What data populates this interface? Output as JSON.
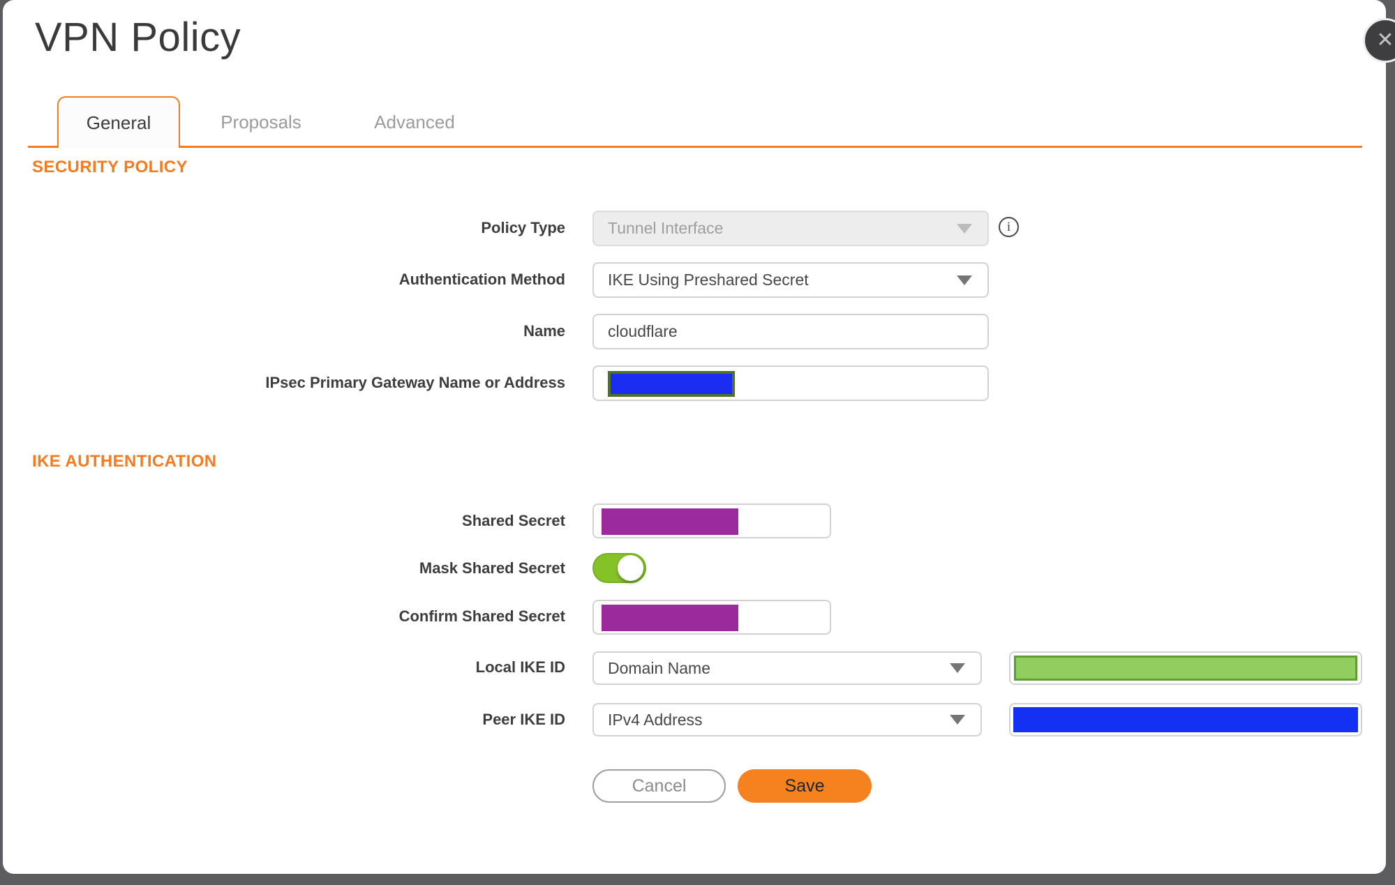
{
  "dialog": {
    "title": "VPN Policy"
  },
  "icons": {
    "close": "✕",
    "info": "i",
    "dropdown_caret": "chevron-down",
    "toggle": "toggle-on"
  },
  "tabs": {
    "general": "General",
    "proposals": "Proposals",
    "advanced": "Advanced",
    "active_tab": "General"
  },
  "sections": {
    "security_policy": "SECURITY POLICY",
    "ike_authentication": "IKE AUTHENTICATION"
  },
  "fields": {
    "policy_type": {
      "label": "Policy Type",
      "value": "Tunnel Interface",
      "state": "disabled"
    },
    "authentication_method": {
      "label": "Authentication Method",
      "value": "IKE Using Preshared Secret"
    },
    "name": {
      "label": "Name",
      "value": "cloudflare"
    },
    "gateway": {
      "label": "IPsec Primary Gateway Name or Address",
      "value": "",
      "redacted": true
    },
    "shared_secret": {
      "label": "Shared Secret",
      "value": "",
      "redacted": true
    },
    "mask_shared_secret": {
      "label": "Mask Shared Secret",
      "state": "on"
    },
    "confirm_shared_secret": {
      "label": "Confirm Shared Secret",
      "value": "",
      "redacted": true
    },
    "local_ike_id": {
      "label": "Local IKE ID",
      "value": "Domain Name",
      "redacted_value": true
    },
    "peer_ike_id": {
      "label": "Peer IKE ID",
      "value": "IPv4 Address",
      "redacted_value": true
    }
  },
  "buttons": {
    "cancel": "Cancel",
    "save": "Save"
  },
  "colors": {
    "accent_orange": "#F47B20",
    "save_orange": "#F6821F",
    "redaction_purple": "#9B2A9D",
    "redaction_blue_gateway": "#1B2DF1",
    "redaction_blue_peer": "#1430F2",
    "redaction_green_fill": "#92CD5F",
    "redaction_green_border": "#5F9E33",
    "gateway_olive_border": "#50702A",
    "toggle_green": "#85C228"
  }
}
